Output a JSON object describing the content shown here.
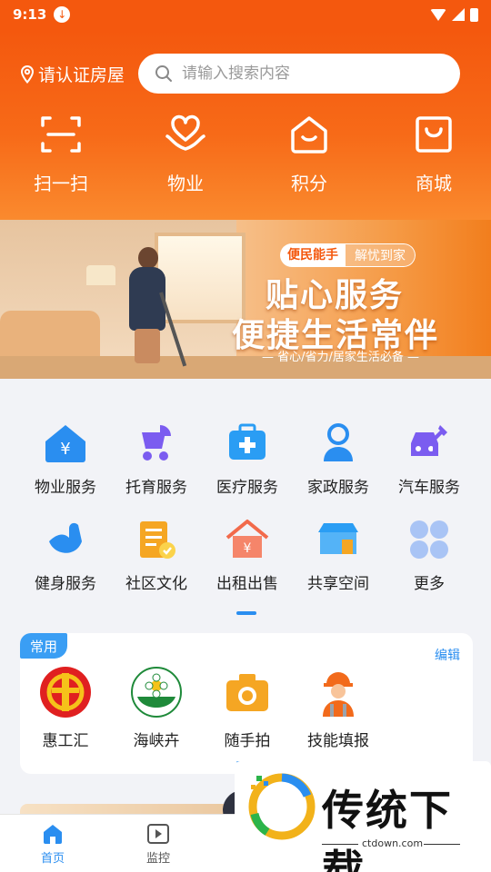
{
  "status_bar": {
    "time": "9:13"
  },
  "header": {
    "location": "请认证房屋",
    "search_placeholder": "请输入搜索内容",
    "quick_actions": [
      {
        "label": "扫一扫",
        "icon": "scan-icon"
      },
      {
        "label": "物业",
        "icon": "heart-hand-icon"
      },
      {
        "label": "积分",
        "icon": "home-smile-icon"
      },
      {
        "label": "商城",
        "icon": "shopping-bag-icon"
      }
    ]
  },
  "banner": {
    "tag_left": "便民能手",
    "tag_right": "解忧到家",
    "title": "贴心服务",
    "subtitle": "便捷生活常伴",
    "caption": "— 省心/省力/居家生活必备 —"
  },
  "services": [
    {
      "label": "物业服务",
      "icon": "property-house-icon",
      "color": "#2a8ef0"
    },
    {
      "label": "托育服务",
      "icon": "baby-stroller-icon",
      "color": "#7b5cf0"
    },
    {
      "label": "医疗服务",
      "icon": "medical-kit-icon",
      "color": "#2a9df4"
    },
    {
      "label": "家政服务",
      "icon": "housekeeper-icon",
      "color": "#2a8ef0"
    },
    {
      "label": "汽车服务",
      "icon": "car-service-icon",
      "color": "#7b5cf0"
    },
    {
      "label": "健身服务",
      "icon": "fitness-arm-icon",
      "color": "#2a8ef0"
    },
    {
      "label": "社区文化",
      "icon": "clipboard-icon",
      "color": "#f5a623"
    },
    {
      "label": "出租出售",
      "icon": "rent-house-icon",
      "color": "#f26a4b"
    },
    {
      "label": "共享空间",
      "icon": "shared-space-icon",
      "color": "#2a9df4"
    },
    {
      "label": "更多",
      "icon": "more-grid-icon",
      "color": "#a9c4f5"
    }
  ],
  "common": {
    "tag": "常用",
    "edit": "编辑",
    "apps": [
      {
        "label": "惠工汇",
        "icon": "union-badge-icon"
      },
      {
        "label": "海峡卉",
        "icon": "flower-logo-icon"
      },
      {
        "label": "随手拍",
        "icon": "camera-icon"
      },
      {
        "label": "技能填报",
        "icon": "worker-icon"
      }
    ]
  },
  "bottom_nav": {
    "items": [
      {
        "label": "首页",
        "icon": "home-icon",
        "active": true
      },
      {
        "label": "监控",
        "icon": "video-icon",
        "active": false
      },
      {
        "label": "",
        "icon": "avatar-icon",
        "active": false
      }
    ]
  },
  "watermark": {
    "title": "传统下载",
    "url": "ctdown.com"
  },
  "colors": {
    "primary": "#f4580e",
    "accent": "#2a8ef0"
  }
}
